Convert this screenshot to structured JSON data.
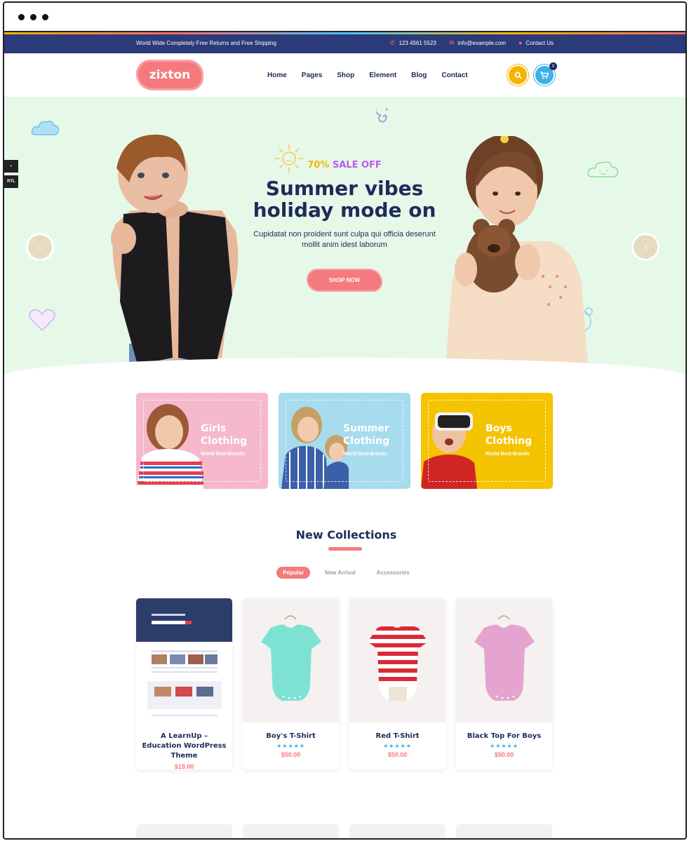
{
  "topbar": {
    "promo": "World Wide Completely Free Returns and Free Shipping",
    "phone": "123 4561 5523",
    "email": "info@example.com",
    "contact": "Contact Us"
  },
  "header": {
    "logo": "zixton",
    "nav": [
      "Home",
      "Pages",
      "Shop",
      "Element",
      "Blog",
      "Contact"
    ],
    "cart_count": "0"
  },
  "hero": {
    "sale_pct": "70%",
    "sale_label": "SALE OFF",
    "headline_1": "Summer vibes",
    "headline_2": "holiday mode on",
    "subtitle_1": "Cupidatat non proident sunt culpa qui officia deserunt",
    "subtitle_2": "mollit anim idest laborum",
    "button": "SHOP NOW",
    "side_rtl": "RTL"
  },
  "categories": [
    {
      "title_1": "Girls",
      "title_2": "Clothing",
      "tagline": "World Best Brands",
      "color": "#f6b9cc"
    },
    {
      "title_1": "Summer",
      "title_2": "Clothing",
      "tagline": "World Best Brands",
      "color": "#a6dced"
    },
    {
      "title_1": "Boys",
      "title_2": "Clothing",
      "tagline": "World Best Brands",
      "color": "#f5c400"
    }
  ],
  "collections": {
    "title": "New Collections",
    "tabs": [
      "Popular",
      "New Arrival",
      "Accessories"
    ],
    "products": [
      {
        "name": "A LearnUp – Education WordPress Theme",
        "price": "$19.00",
        "stars": "",
        "thumb": "theme"
      },
      {
        "name": "Boy's T-Shirt",
        "price": "$50.00",
        "stars": "★★★★★",
        "thumb": "mint"
      },
      {
        "name": "Red T-Shirt",
        "price": "$50.00",
        "stars": "★★★★★",
        "thumb": "stripe"
      },
      {
        "name": "Black Top For Boys",
        "price": "$50.00",
        "stars": "★★★★★",
        "thumb": "pink"
      }
    ]
  },
  "colors": {
    "navy": "#1e2b5a",
    "coral": "#f47a7e",
    "yellow": "#f5b400",
    "sky": "#3fb0e6",
    "mint_bg": "#e6f9e9"
  }
}
